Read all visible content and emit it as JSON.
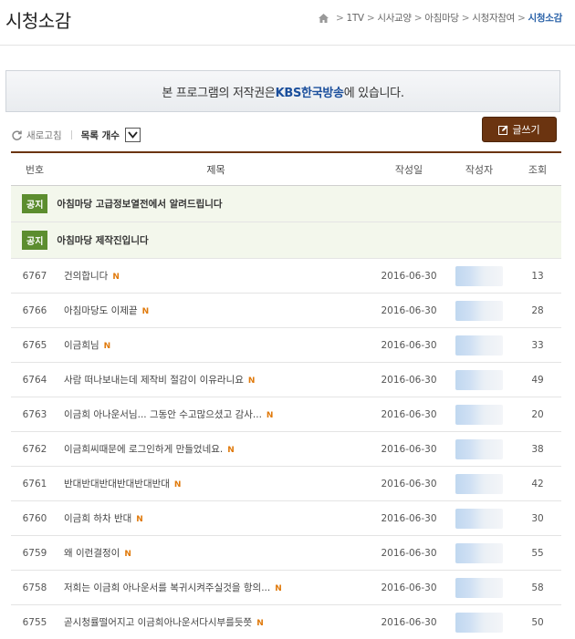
{
  "header": {
    "title": "시청소감",
    "breadcrumb": [
      "1TV",
      "시사교양",
      "아침마당",
      "시청자참여",
      "시청소감"
    ],
    "breadcrumb_sep": ">"
  },
  "banner": {
    "prefix": "본 프로그램의 저작권은 ",
    "brand": "KBS한국방송",
    "suffix": "에 있습니다."
  },
  "toolbar": {
    "refresh_label": "새로고침",
    "count_label": "목록 개수",
    "write_label": "글쓰기"
  },
  "table": {
    "columns": [
      "번호",
      "제목",
      "작성일",
      "작성자",
      "조회"
    ],
    "notice_badge": "공지",
    "notices": [
      "아침마당 고급정보열전에서 알려드립니다",
      "아침마당 제작진입니다"
    ],
    "new_badge": "N",
    "rows": [
      {
        "no": "6767",
        "title": "건의합니다",
        "date": "2016-06-30",
        "views": "13"
      },
      {
        "no": "6766",
        "title": "아침마당도 이제끝",
        "date": "2016-06-30",
        "views": "28"
      },
      {
        "no": "6765",
        "title": "이금희님",
        "date": "2016-06-30",
        "views": "33"
      },
      {
        "no": "6764",
        "title": "사람 떠나보내는데 제작비 절감이 이유라니요",
        "date": "2016-06-30",
        "views": "49"
      },
      {
        "no": "6763",
        "title": "이금희 아나운서님... 그동안 수고많으셨고 감사...",
        "date": "2016-06-30",
        "views": "20"
      },
      {
        "no": "6762",
        "title": "이금희씨때문에 로그인하게 만들었네요.",
        "date": "2016-06-30",
        "views": "38"
      },
      {
        "no": "6761",
        "title": "반대반대반대반대반대반대",
        "date": "2016-06-30",
        "views": "42"
      },
      {
        "no": "6760",
        "title": "이금희 하차 반대",
        "date": "2016-06-30",
        "views": "30"
      },
      {
        "no": "6759",
        "title": "왜 이런결정이",
        "date": "2016-06-30",
        "views": "55"
      },
      {
        "no": "6758",
        "title": "저희는 이금희 아나운서를 복귀시켜주실것을 항의...",
        "date": "2016-06-30",
        "views": "58"
      },
      {
        "no": "6755",
        "title": "곧시청률떨어지고 이금희아나운서다시부를듯쯧",
        "date": "2016-06-30",
        "views": "50"
      }
    ]
  },
  "colors": {
    "accent": "#6b3410",
    "brand": "#1b4f9c",
    "notice_green": "#5c8d2f",
    "new_orange": "#e07a0c"
  },
  "icons": [
    "home-icon",
    "refresh-icon",
    "chevron-down-icon",
    "pencil-icon"
  ]
}
